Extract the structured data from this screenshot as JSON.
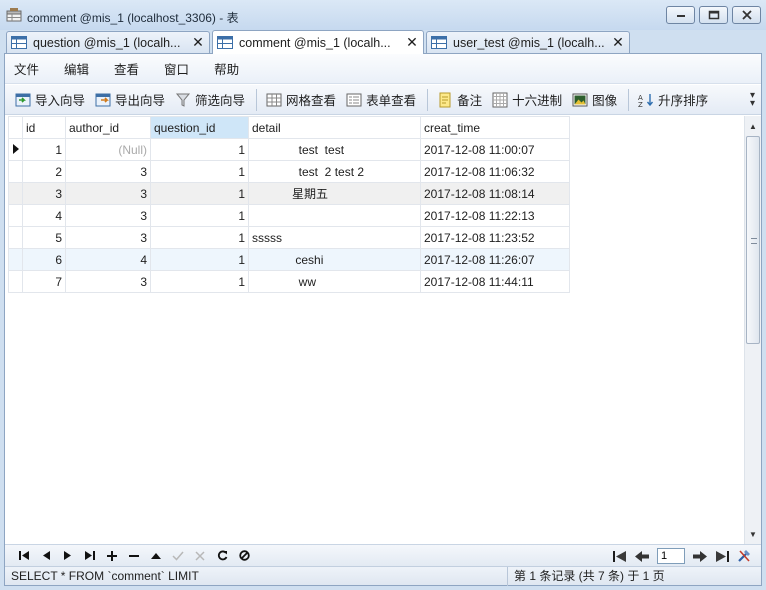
{
  "window": {
    "title": "comment @mis_1 (localhost_3306) - 表"
  },
  "tabs": [
    {
      "label": "question @mis_1 (localh...",
      "active": false
    },
    {
      "label": "comment @mis_1 (localh...",
      "active": true
    },
    {
      "label": "user_test @mis_1 (localh...",
      "active": false
    }
  ],
  "menu": [
    "文件",
    "编辑",
    "查看",
    "窗口",
    "帮助"
  ],
  "toolbar": {
    "import": "导入向导",
    "export": "导出向导",
    "filter": "筛选向导",
    "grid_view": "网格查看",
    "form_view": "表单查看",
    "memo": "备注",
    "hex": "十六进制",
    "image": "图像",
    "sort_asc": "升序排序"
  },
  "grid": {
    "columns": [
      "id",
      "author_id",
      "question_id",
      "detail",
      "creat_time"
    ],
    "rows": [
      {
        "id": "1",
        "author_id": "(Null)",
        "question_id": "1",
        "detail": "              test  test",
        "creat_time": "2017-12-08 11:00:07"
      },
      {
        "id": "2",
        "author_id": "3",
        "question_id": "1",
        "detail": "              test  2 test 2",
        "creat_time": "2017-12-08 11:06:32"
      },
      {
        "id": "3",
        "author_id": "3",
        "question_id": "1",
        "detail": "            星期五",
        "creat_time": "2017-12-08 11:08:14"
      },
      {
        "id": "4",
        "author_id": "3",
        "question_id": "1",
        "detail": "",
        "creat_time": "2017-12-08 11:22:13"
      },
      {
        "id": "5",
        "author_id": "3",
        "question_id": "1",
        "detail": "sssss",
        "creat_time": "2017-12-08 11:23:52"
      },
      {
        "id": "6",
        "author_id": "4",
        "question_id": "1",
        "detail": "             ceshi",
        "creat_time": "2017-12-08 11:26:07"
      },
      {
        "id": "7",
        "author_id": "3",
        "question_id": "1",
        "detail": "              ww",
        "creat_time": "2017-12-08 11:44:11"
      }
    ]
  },
  "navigation": {
    "page_value": "1"
  },
  "status": {
    "sql": "SELECT * FROM `comment` LIMIT",
    "page_info": "第 1 条记录 (共 7 条) 于 1 页"
  }
}
